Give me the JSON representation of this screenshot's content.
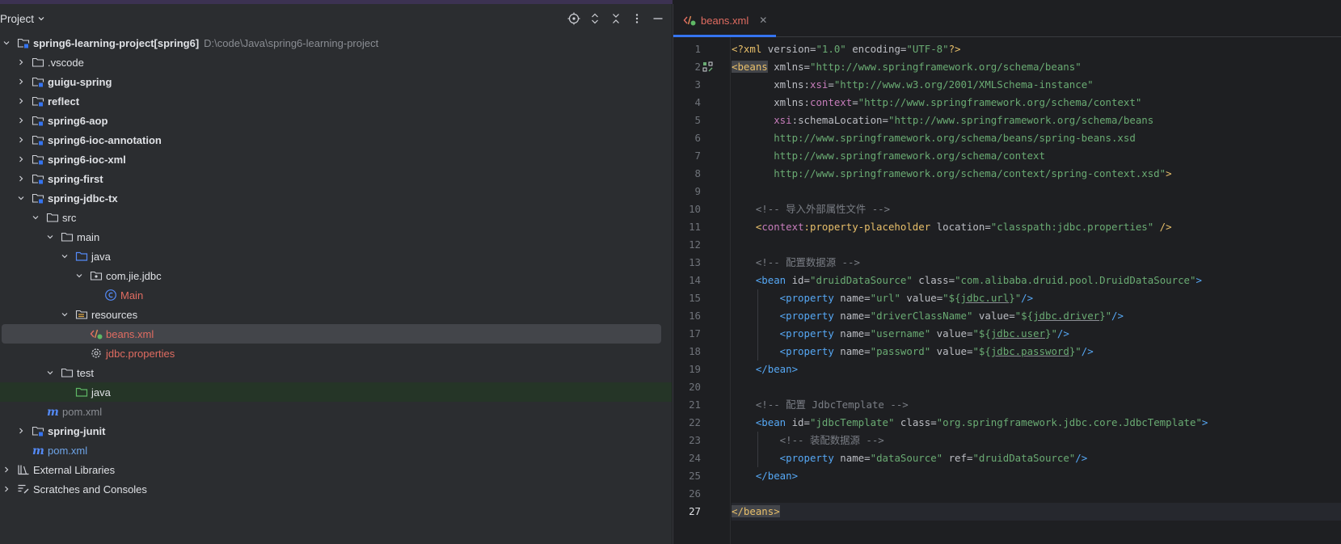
{
  "project_panel": {
    "title": "Project",
    "tree": [
      {
        "depth": 0,
        "expanded": true,
        "icon": "module-folder-icon",
        "label": "spring6-learning-project",
        "suffix": " [spring6]",
        "path": "D:\\code\\Java\\spring6-learning-project",
        "style": "bold"
      },
      {
        "depth": 1,
        "expanded": false,
        "icon": "folder-icon",
        "label": ".vscode",
        "style": ""
      },
      {
        "depth": 1,
        "expanded": false,
        "icon": "module-folder-icon",
        "label": "guigu-spring",
        "style": "bold"
      },
      {
        "depth": 1,
        "expanded": false,
        "icon": "module-folder-icon",
        "label": "reflect",
        "style": "bold"
      },
      {
        "depth": 1,
        "expanded": false,
        "icon": "module-folder-icon",
        "label": "spring6-aop",
        "style": "bold"
      },
      {
        "depth": 1,
        "expanded": false,
        "icon": "module-folder-icon",
        "label": "spring6-ioc-annotation",
        "style": "bold"
      },
      {
        "depth": 1,
        "expanded": false,
        "icon": "module-folder-icon",
        "label": "spring6-ioc-xml",
        "style": "bold"
      },
      {
        "depth": 1,
        "expanded": false,
        "icon": "module-folder-icon",
        "label": "spring-first",
        "style": "bold"
      },
      {
        "depth": 1,
        "expanded": true,
        "icon": "module-folder-icon",
        "label": "spring-jdbc-tx",
        "style": "bold"
      },
      {
        "depth": 2,
        "expanded": true,
        "icon": "folder-icon",
        "label": "src",
        "style": ""
      },
      {
        "depth": 3,
        "expanded": true,
        "icon": "folder-icon",
        "label": "main",
        "style": ""
      },
      {
        "depth": 4,
        "expanded": true,
        "icon": "source-folder-icon",
        "label": "java",
        "style": ""
      },
      {
        "depth": 5,
        "expanded": true,
        "icon": "package-icon",
        "label": "com.jie.jdbc",
        "style": ""
      },
      {
        "depth": 6,
        "expanded": null,
        "icon": "class-icon",
        "label": "Main",
        "style": "red"
      },
      {
        "depth": 4,
        "expanded": true,
        "icon": "resources-folder-icon",
        "label": "resources",
        "style": ""
      },
      {
        "depth": 5,
        "expanded": null,
        "icon": "xml-file-icon",
        "label": "beans.xml",
        "style": "red",
        "selected": true
      },
      {
        "depth": 5,
        "expanded": null,
        "icon": "properties-file-icon",
        "label": "jdbc.properties",
        "style": "red"
      },
      {
        "depth": 3,
        "expanded": true,
        "icon": "folder-icon",
        "label": "test",
        "style": ""
      },
      {
        "depth": 4,
        "expanded": null,
        "icon": "test-folder-icon",
        "label": "java",
        "style": "",
        "highlight": true
      },
      {
        "depth": 2,
        "expanded": null,
        "icon": "maven-icon",
        "label": "pom.xml",
        "style": "grey"
      },
      {
        "depth": 1,
        "expanded": false,
        "icon": "module-folder-icon",
        "label": "spring-junit",
        "style": "bold"
      },
      {
        "depth": 1,
        "expanded": null,
        "icon": "maven-icon",
        "label": "pom.xml",
        "style": "blue"
      },
      {
        "depth": 0,
        "expanded": false,
        "icon": "libraries-icon",
        "label": "External Libraries",
        "style": ""
      },
      {
        "depth": 0,
        "expanded": false,
        "icon": "scratches-icon",
        "label": "Scratches and Consoles",
        "style": ""
      }
    ]
  },
  "editor": {
    "tab_label": "beans.xml",
    "current_line": 27,
    "lines": [
      [
        [
          "t-tag",
          "<?xml "
        ],
        [
          "t-attr",
          "version"
        ],
        [
          "t-pun",
          "="
        ],
        [
          "t-str",
          "\"1.0\""
        ],
        [
          "t-attr",
          " encoding"
        ],
        [
          "t-pun",
          "="
        ],
        [
          "t-str",
          "\"UTF-8\""
        ],
        [
          "t-tag",
          "?>"
        ]
      ],
      [
        [
          "t-tag t-sel",
          "<beans"
        ],
        [
          "t-attr",
          " xmlns"
        ],
        [
          "t-pun",
          "="
        ],
        [
          "t-str",
          "\"http://www.springframework.org/schema/beans\""
        ]
      ],
      [
        [
          "t-attr",
          "       xmlns:"
        ],
        [
          "t-ns",
          "xsi"
        ],
        [
          "t-pun",
          "="
        ],
        [
          "t-str",
          "\"http://www.w3.org/2001/XMLSchema-instance\""
        ]
      ],
      [
        [
          "t-attr",
          "       xmlns:"
        ],
        [
          "t-ns",
          "context"
        ],
        [
          "t-pun",
          "="
        ],
        [
          "t-str",
          "\"http://www.springframework.org/schema/context\""
        ]
      ],
      [
        [
          "t-ns",
          "       xsi"
        ],
        [
          "t-attr",
          ":schemaLocation"
        ],
        [
          "t-pun",
          "="
        ],
        [
          "t-str",
          "\"http://www.springframework.org/schema/beans"
        ]
      ],
      [
        [
          "t-str",
          "       http://www.springframework.org/schema/beans/spring-beans.xsd"
        ]
      ],
      [
        [
          "t-str",
          "       http://www.springframework.org/schema/context"
        ]
      ],
      [
        [
          "t-str",
          "       http://www.springframework.org/schema/context/spring-context.xsd\""
        ],
        [
          "t-tag",
          ">"
        ]
      ],
      [],
      [
        [
          "t-com",
          "    <!-- 导入外部属性文件 -->"
        ]
      ],
      [
        [
          "t-tag",
          "    <"
        ],
        [
          "t-ns",
          "context"
        ],
        [
          "t-tag",
          ":property-placeholder"
        ],
        [
          "t-attr",
          " location"
        ],
        [
          "t-pun",
          "="
        ],
        [
          "t-str",
          "\"classpath:jdbc.properties\""
        ],
        [
          "t-tag",
          " />"
        ]
      ],
      [],
      [
        [
          "t-com",
          "    <!-- 配置数据源 -->"
        ]
      ],
      [
        [
          "t-tag2",
          "    <bean"
        ],
        [
          "t-attr",
          " id"
        ],
        [
          "t-pun",
          "="
        ],
        [
          "t-str",
          "\"druidDataSource\""
        ],
        [
          "t-attr",
          " class"
        ],
        [
          "t-pun",
          "="
        ],
        [
          "t-str",
          "\"com.alibaba.druid.pool.DruidDataSource\""
        ],
        [
          "t-tag2",
          ">"
        ]
      ],
      [
        [
          "t-tag2",
          "        <property"
        ],
        [
          "t-attr",
          " name"
        ],
        [
          "t-pun",
          "="
        ],
        [
          "t-str",
          "\"url\""
        ],
        [
          "t-attr",
          " value"
        ],
        [
          "t-pun",
          "="
        ],
        [
          "t-str",
          "\"${"
        ],
        [
          "t-str t-u",
          "jdbc.url"
        ],
        [
          "t-str",
          "}\""
        ],
        [
          "t-tag2",
          "/>"
        ]
      ],
      [
        [
          "t-tag2",
          "        <property"
        ],
        [
          "t-attr",
          " name"
        ],
        [
          "t-pun",
          "="
        ],
        [
          "t-str",
          "\"driverClassName\""
        ],
        [
          "t-attr",
          " value"
        ],
        [
          "t-pun",
          "="
        ],
        [
          "t-str",
          "\"${"
        ],
        [
          "t-str t-u",
          "jdbc.driver"
        ],
        [
          "t-str",
          "}\""
        ],
        [
          "t-tag2",
          "/>"
        ]
      ],
      [
        [
          "t-tag2",
          "        <property"
        ],
        [
          "t-attr",
          " name"
        ],
        [
          "t-pun",
          "="
        ],
        [
          "t-str",
          "\"username\""
        ],
        [
          "t-attr",
          " value"
        ],
        [
          "t-pun",
          "="
        ],
        [
          "t-str",
          "\"${"
        ],
        [
          "t-str t-u",
          "jdbc.user"
        ],
        [
          "t-str",
          "}\""
        ],
        [
          "t-tag2",
          "/>"
        ]
      ],
      [
        [
          "t-tag2",
          "        <property"
        ],
        [
          "t-attr",
          " name"
        ],
        [
          "t-pun",
          "="
        ],
        [
          "t-str",
          "\"password\""
        ],
        [
          "t-attr",
          " value"
        ],
        [
          "t-pun",
          "="
        ],
        [
          "t-str",
          "\"${"
        ],
        [
          "t-str t-u",
          "jdbc.password"
        ],
        [
          "t-str",
          "}\""
        ],
        [
          "t-tag2",
          "/>"
        ]
      ],
      [
        [
          "t-tag2",
          "    </bean>"
        ]
      ],
      [],
      [
        [
          "t-com",
          "    <!-- 配置 JdbcTemplate -->"
        ]
      ],
      [
        [
          "t-tag2",
          "    <bean"
        ],
        [
          "t-attr",
          " id"
        ],
        [
          "t-pun",
          "="
        ],
        [
          "t-str",
          "\"jdbcTemplate\""
        ],
        [
          "t-attr",
          " class"
        ],
        [
          "t-pun",
          "="
        ],
        [
          "t-str",
          "\"org.springframework.jdbc.core.JdbcTemplate\""
        ],
        [
          "t-tag2",
          ">"
        ]
      ],
      [
        [
          "t-com",
          "        <!-- 装配数据源 -->"
        ]
      ],
      [
        [
          "t-tag2",
          "        <property"
        ],
        [
          "t-attr",
          " name"
        ],
        [
          "t-pun",
          "="
        ],
        [
          "t-str",
          "\"dataSource\""
        ],
        [
          "t-attr",
          " ref"
        ],
        [
          "t-pun",
          "="
        ],
        [
          "t-str",
          "\"druidDataSource\""
        ],
        [
          "t-tag2",
          "/>"
        ]
      ],
      [
        [
          "t-tag2",
          "    </bean>"
        ]
      ],
      [],
      [
        [
          "t-tag t-sel",
          "</beans>"
        ]
      ]
    ]
  },
  "colors": {
    "accent": "#3574f0",
    "xml_tag": "#e8bf6a",
    "string": "#6aab73",
    "comment": "#7a7e85",
    "namespace": "#c77dbb",
    "modified_file": "#e06c61"
  }
}
